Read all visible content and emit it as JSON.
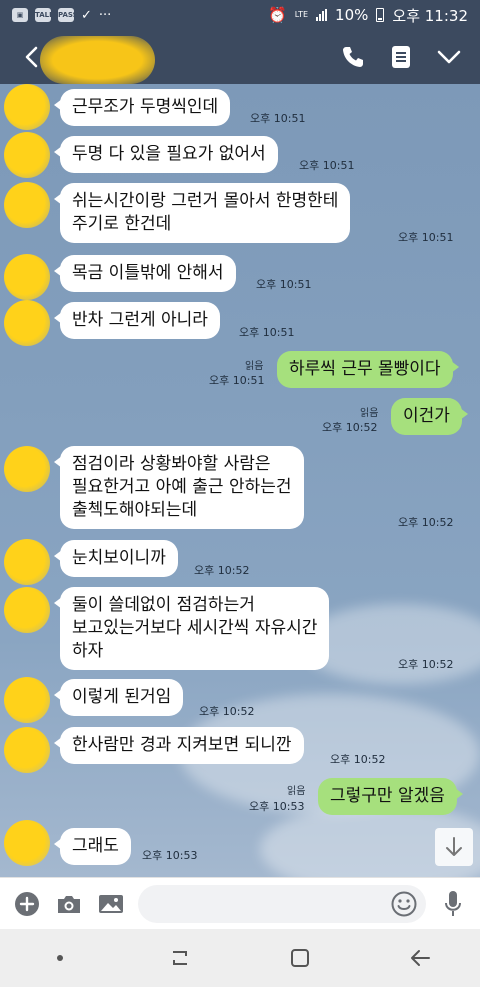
{
  "status_bar": {
    "app_icons": [
      "TALK",
      "PASS"
    ],
    "more": "···",
    "network": "LTE",
    "battery": "10%",
    "time": "오후 11:32"
  },
  "header": {
    "icons": [
      "back-icon",
      "phone-icon",
      "menu-icon",
      "chevron-down-icon"
    ]
  },
  "messages": [
    {
      "side": "left",
      "text": "근무조가 두명씩인데",
      "time": "오후 10:51"
    },
    {
      "side": "left",
      "text": "두명 다 있을 필요가 없어서",
      "time": "오후 10:51"
    },
    {
      "side": "left",
      "text": "쉬는시간이랑 그런거 몰아서 한명한테\n주기로 한건데",
      "time": "오후 10:51"
    },
    {
      "side": "left",
      "text": "목금 이틀밖에 안해서",
      "time": "오후 10:51"
    },
    {
      "side": "left",
      "text": "반차 그런게 아니라",
      "time": "오후 10:51"
    },
    {
      "side": "right",
      "text": "하루씩 근무 몰빵이다",
      "read": "읽음",
      "time": "오후 10:51"
    },
    {
      "side": "right",
      "text": "이건가",
      "read": "읽음",
      "time": "오후 10:52"
    },
    {
      "side": "left",
      "text": "점검이라 상황봐야할 사람은\n필요한거고 아예 출근 안하는건\n출첵도해야되는데",
      "time": "오후 10:52"
    },
    {
      "side": "left",
      "text": "눈치보이니까",
      "time": "오후 10:52"
    },
    {
      "side": "left",
      "text": "둘이 쓸데없이 점검하는거\n보고있는거보다 세시간씩 자유시간\n하자",
      "time": "오후 10:52"
    },
    {
      "side": "left",
      "text": "이렇게 된거임",
      "time": "오후 10:52"
    },
    {
      "side": "left",
      "text": "한사람만 경과 지켜보면 되니깐",
      "time": "오후 10:52"
    },
    {
      "side": "right",
      "text": "그렇구만 알겠음",
      "read": "읽음",
      "time": "오후 10:53"
    },
    {
      "side": "left",
      "text": "그래도",
      "time": "오후 10:53"
    }
  ],
  "input_bar": {
    "placeholder": "",
    "icons": [
      "plus-icon",
      "camera-icon",
      "image-icon",
      "emoji-icon",
      "mic-icon"
    ]
  },
  "nav_bar": {
    "icons": [
      "dot-icon",
      "recent-apps-icon",
      "home-icon",
      "back-arrow-icon"
    ]
  }
}
